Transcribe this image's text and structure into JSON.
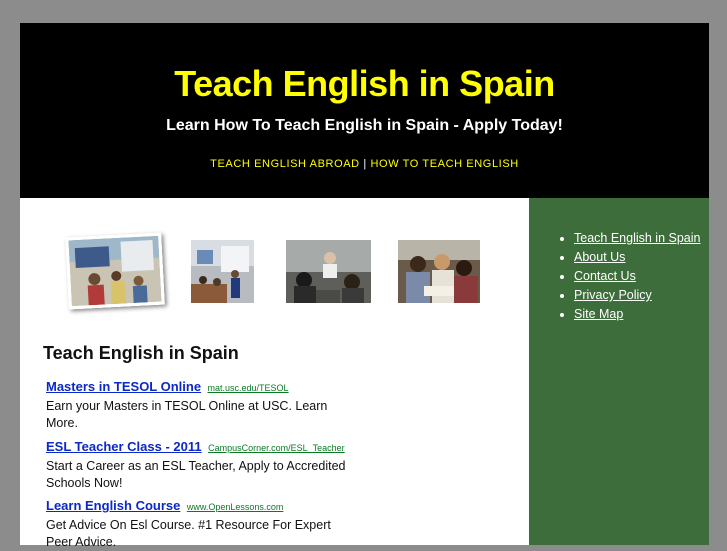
{
  "header": {
    "title": "Teach English in Spain",
    "tagline": "Learn How To Teach English in Spain - Apply Today!",
    "nav": [
      {
        "label": "TEACH ENGLISH ABROAD"
      },
      {
        "label": "HOW TO TEACH ENGLISH"
      }
    ],
    "nav_separator": "|"
  },
  "main": {
    "heading": "Teach English in Spain",
    "photos": [
      {
        "icon": "classroom-photo"
      },
      {
        "icon": "classroom-photo"
      },
      {
        "icon": "lecture-photo"
      },
      {
        "icon": "students-photo"
      }
    ],
    "ads": [
      {
        "title": "Masters in TESOL Online",
        "url": "mat.usc.edu/TESOL",
        "text": "Earn your Masters in TESOL Online at USC. Learn More."
      },
      {
        "title": "ESL Teacher Class - 2011",
        "url": "CampusCorner.com/ESL_Teacher",
        "text": "Start a Career as an ESL Teacher, Apply to Accredited Schools Now!"
      },
      {
        "title": "Learn English Course",
        "url": "www.OpenLessons.com",
        "text": "Get Advice On Esl Course. #1 Resource For Expert Peer Advice."
      }
    ]
  },
  "sidebar": {
    "links": [
      {
        "label": "Teach English in Spain"
      },
      {
        "label": "About Us"
      },
      {
        "label": "Contact Us"
      },
      {
        "label": "Privacy Policy"
      },
      {
        "label": "Site Map"
      }
    ]
  },
  "colors": {
    "header_bg": "#000000",
    "title": "#ffff00",
    "sidebar_bg": "#3d6d3a",
    "ad_link": "#0b28c8",
    "ad_url": "#0b7a24"
  }
}
